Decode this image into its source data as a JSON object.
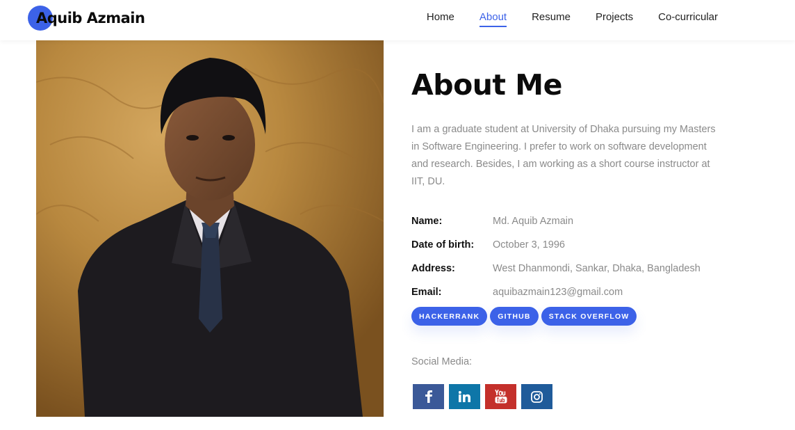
{
  "header": {
    "brand_initial": "A",
    "brand_name": "Aquib Azmain",
    "nav": [
      "Home",
      "About",
      "Resume",
      "Projects",
      "Co-curricular"
    ],
    "active_nav": "About"
  },
  "about": {
    "title": "About Me",
    "intro": "I am a graduate student at University of Dhaka pursuing my Masters in Software Engineering. I prefer to work on software development and research. Besides, I am working as a short course instructor at IIT, DU.",
    "info": [
      {
        "label": "Name:",
        "value": "Md. Aquib Azmain"
      },
      {
        "label": "Date of birth:",
        "value": "October 3, 1996"
      },
      {
        "label": "Address:",
        "value": "West Dhanmondi, Sankar, Dhaka, Bangladesh"
      },
      {
        "label": "Email:",
        "value": "aquibazmain123@gmail.com"
      }
    ],
    "profile_links": [
      "HACKERRANK",
      "GITHUB",
      "STACK OVERFLOW"
    ],
    "social_label": "Social Media:",
    "social_icons": [
      "facebook-icon",
      "linkedin-icon",
      "youtube-icon",
      "instagram-icon"
    ]
  },
  "colors": {
    "accent": "#3c62e8",
    "facebook": "#3b5998",
    "linkedin": "#0e76a8",
    "youtube": "#c4302b",
    "instagram": "#1f5b9a"
  }
}
